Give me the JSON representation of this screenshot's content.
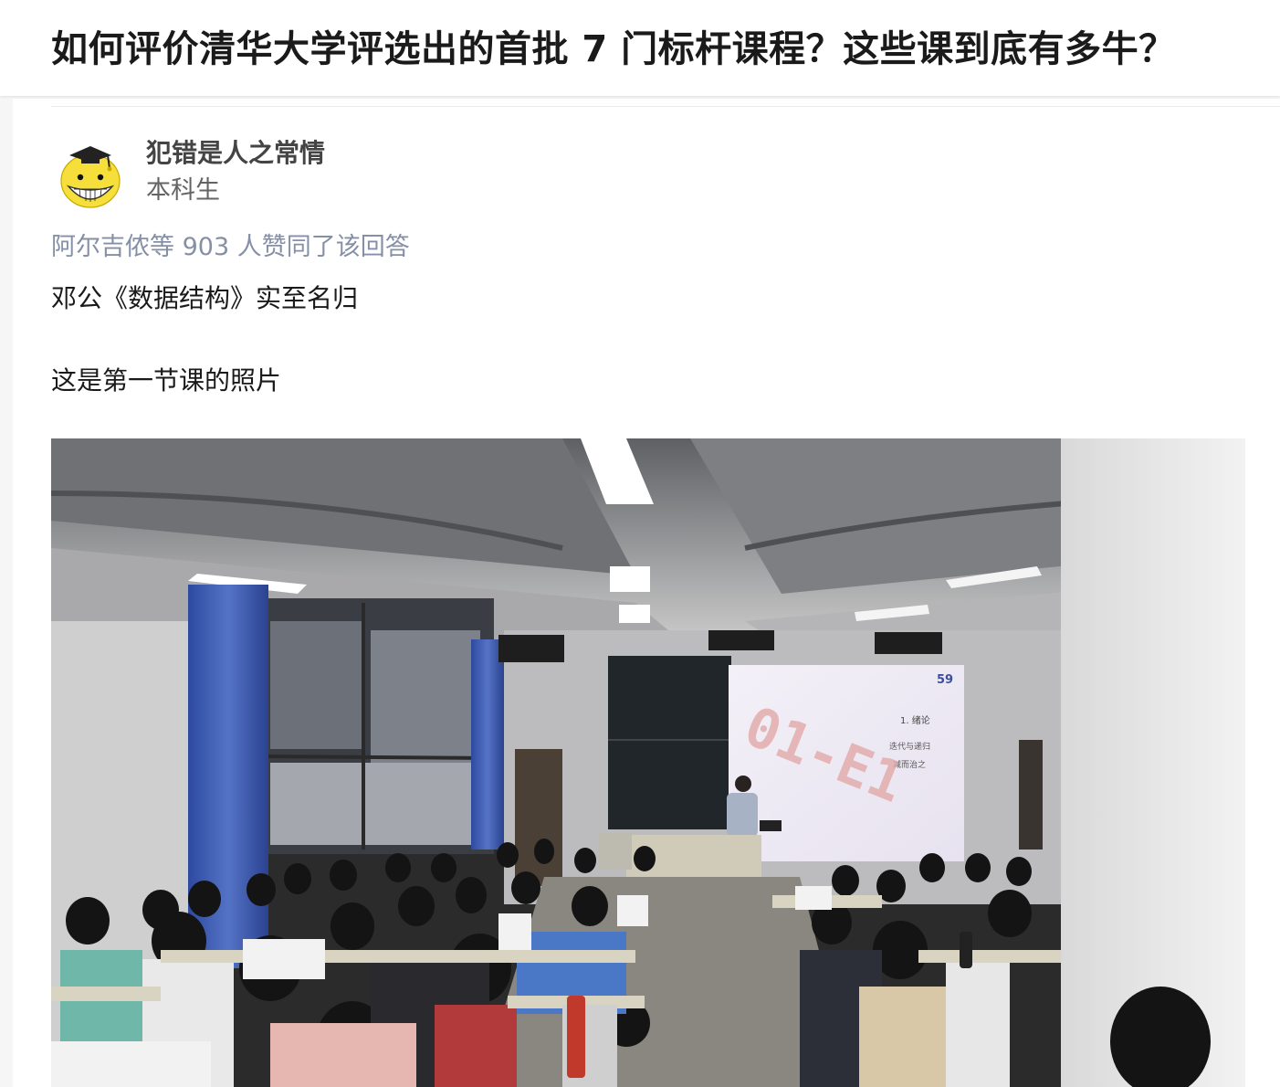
{
  "question": {
    "title": "如何评价清华大学评选出的首批 7 门标杆课程？这些课到底有多牛？"
  },
  "answer": {
    "author": {
      "name": "犯错是人之常情",
      "headline": "本科生"
    },
    "voters_text": "阿尔吉侬等 903 人赞同了该回答",
    "paragraphs": [
      "邓公《数据结构》实至名归",
      "这是第一节课的照片"
    ],
    "photo": {
      "slide_page_number": "59",
      "slide_big_text": "01-E1",
      "slide_heading": "1. 绪论",
      "slide_line1": "迭代与递归",
      "slide_line2": "减而治之"
    }
  }
}
